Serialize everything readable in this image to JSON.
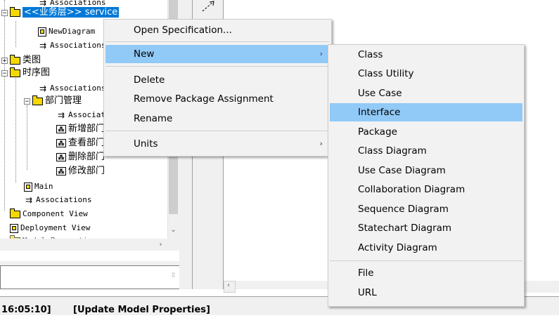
{
  "tree": {
    "items": [
      {
        "label": "Associations"
      },
      {
        "label": "<<业务层>> service"
      },
      {
        "label": "NewDiagram"
      },
      {
        "label": "Associations"
      },
      {
        "label": "类图"
      },
      {
        "label": "时序图"
      },
      {
        "label": "Associations"
      },
      {
        "label": "部门管理"
      },
      {
        "label": "Associations"
      },
      {
        "label": "新增部门"
      },
      {
        "label": "查看部门"
      },
      {
        "label": "删除部门"
      },
      {
        "label": "修改部门"
      },
      {
        "label": "Main"
      },
      {
        "label": "Associations"
      },
      {
        "label": "Component View"
      },
      {
        "label": "Deployment View"
      },
      {
        "label": "Model Properties"
      }
    ]
  },
  "context_menu": {
    "items": [
      {
        "label": "Open Specification..."
      },
      {
        "label": "New",
        "submenu_arrow": "›"
      },
      {
        "label": "Delete"
      },
      {
        "label": "Remove Package Assignment"
      },
      {
        "label": "Rename"
      },
      {
        "label": "Units",
        "submenu_arrow": "›"
      }
    ],
    "highlighted": "New"
  },
  "submenu": {
    "items": [
      {
        "label": "Class"
      },
      {
        "label": "Class Utility"
      },
      {
        "label": "Use Case"
      },
      {
        "label": "Interface"
      },
      {
        "label": "Package"
      },
      {
        "label": "Class Diagram"
      },
      {
        "label": "Use Case Diagram"
      },
      {
        "label": "Collaboration Diagram"
      },
      {
        "label": "Sequence Diagram"
      },
      {
        "label": "Statechart Diagram"
      },
      {
        "label": "Activity Diagram"
      },
      {
        "label": "File"
      },
      {
        "label": "URL"
      }
    ],
    "highlighted": "Interface"
  },
  "status": {
    "time": "16:05:10]",
    "message": "[Update Model Properties]"
  },
  "colors": {
    "selection": "#0078d7",
    "menu_highlight": "#91c9f7",
    "folder": "#f5d800"
  }
}
